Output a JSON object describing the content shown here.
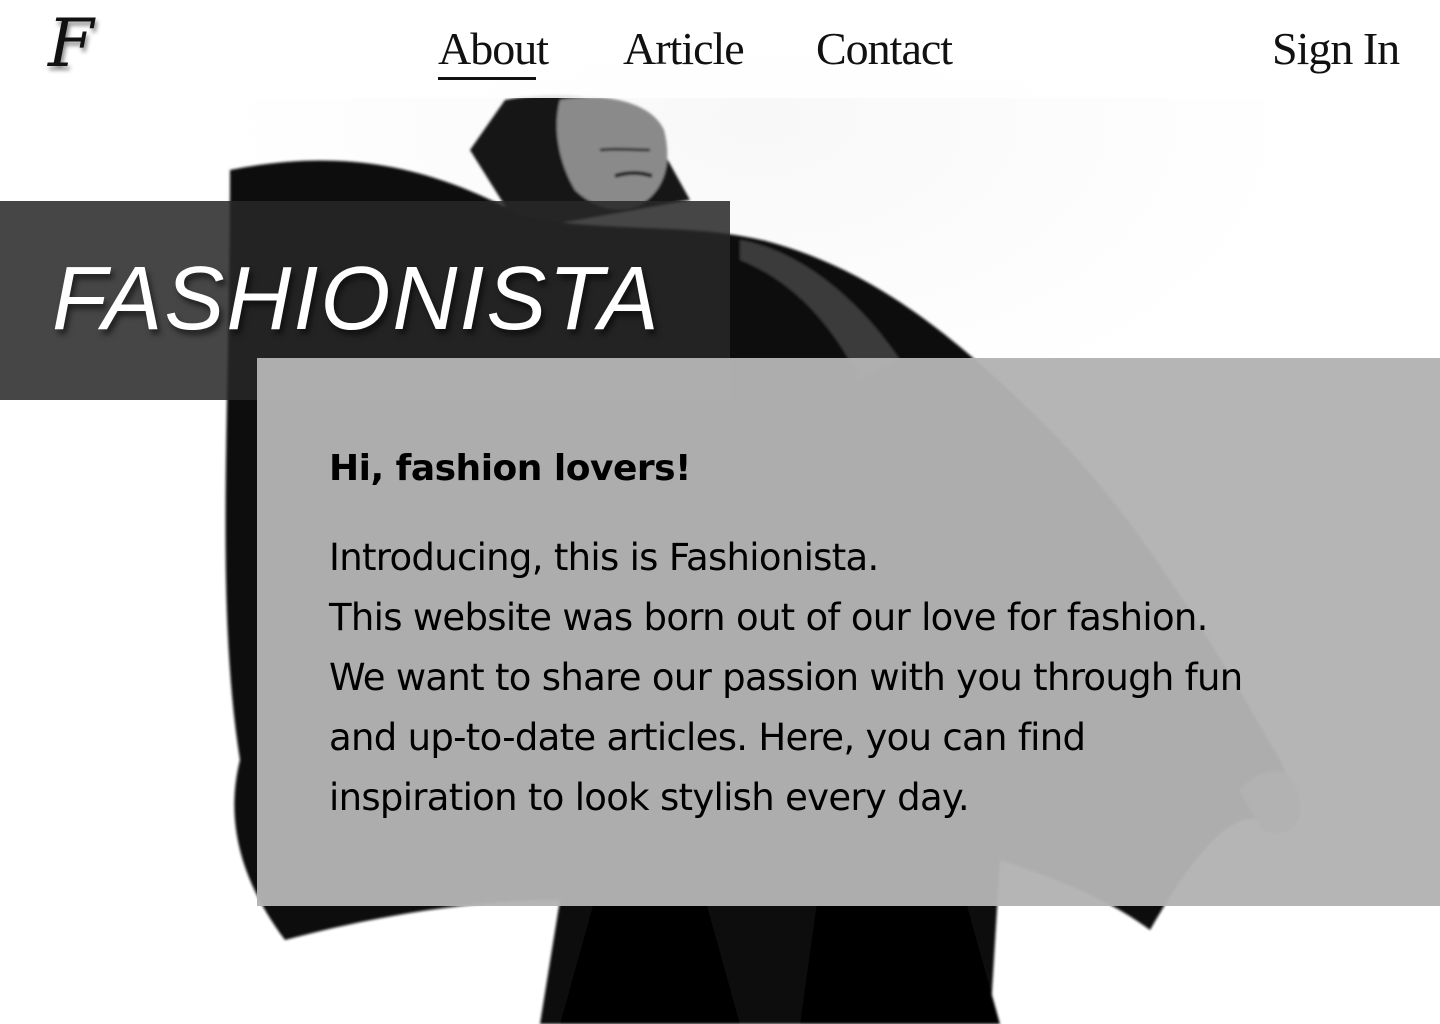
{
  "brand": {
    "logo_letter": "F"
  },
  "nav": {
    "links": [
      {
        "label": "About",
        "active": true
      },
      {
        "label": "Article",
        "active": false
      },
      {
        "label": "Contact",
        "active": false
      }
    ],
    "sign_in": "Sign In"
  },
  "hero": {
    "title": "FASHIONISTA"
  },
  "intro": {
    "heading": "Hi, fashion lovers!",
    "lines": [
      "Introducing, this is Fashionista.",
      "This website was born out of our love for fashion.",
      "We want to share our passion with you through fun",
      "and up-to-date articles. Here, you can find",
      "inspiration to look stylish every day."
    ]
  },
  "colors": {
    "title_box": "#282828",
    "intro_box": "#b3b3b3",
    "text": "#000000",
    "title_text": "#ffffff"
  },
  "icons": {
    "logo": "script-f-monogram"
  }
}
